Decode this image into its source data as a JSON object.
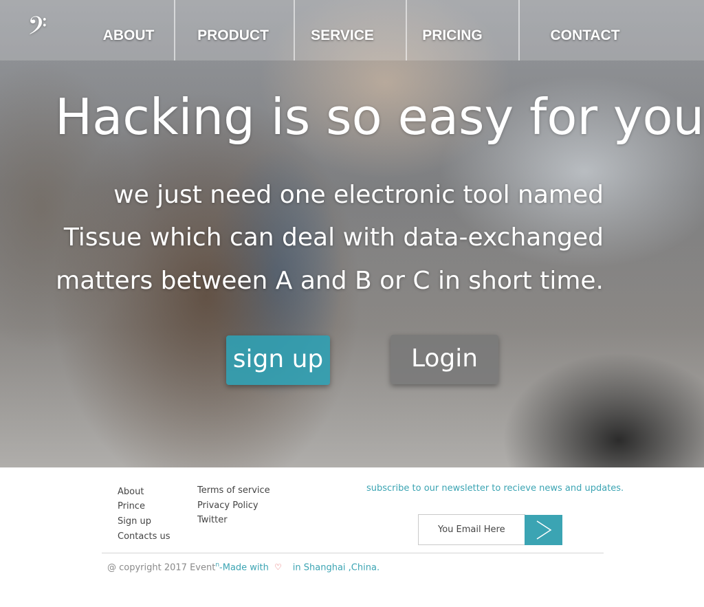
{
  "nav": {
    "logo": "𝄢",
    "items": [
      {
        "label": "ABOUT"
      },
      {
        "label": "PRODUCT"
      },
      {
        "label": "SERVICE"
      },
      {
        "label": "PRICING"
      },
      {
        "label": "CONTACT"
      }
    ]
  },
  "hero": {
    "headline": "Hacking is so easy for you!",
    "subtext": [
      "we just need one electronic tool named",
      "Tissue which can deal with data-exchanged",
      "matters between A and B or C in short time."
    ],
    "signup_label": "sign up",
    "login_label": "Login"
  },
  "footer": {
    "links_col1": [
      "About",
      "Prince",
      "Sign up",
      "Contacts us"
    ],
    "links_col2": [
      "Terms of service",
      "Privacy Policy",
      "Twitter"
    ],
    "newsletter_text": "subscribe to our newsletter  to recieve news and updates.",
    "email_placeholder": "You Email Here",
    "copyright_prefix": "@ copyright 2017 Event",
    "copyright_sup": "n",
    "made_with": "-Made with",
    "location": "in Shanghai ,China."
  },
  "colors": {
    "accent": "#3ba4b3",
    "heart": "#e04848",
    "text_dark": "#444444"
  }
}
